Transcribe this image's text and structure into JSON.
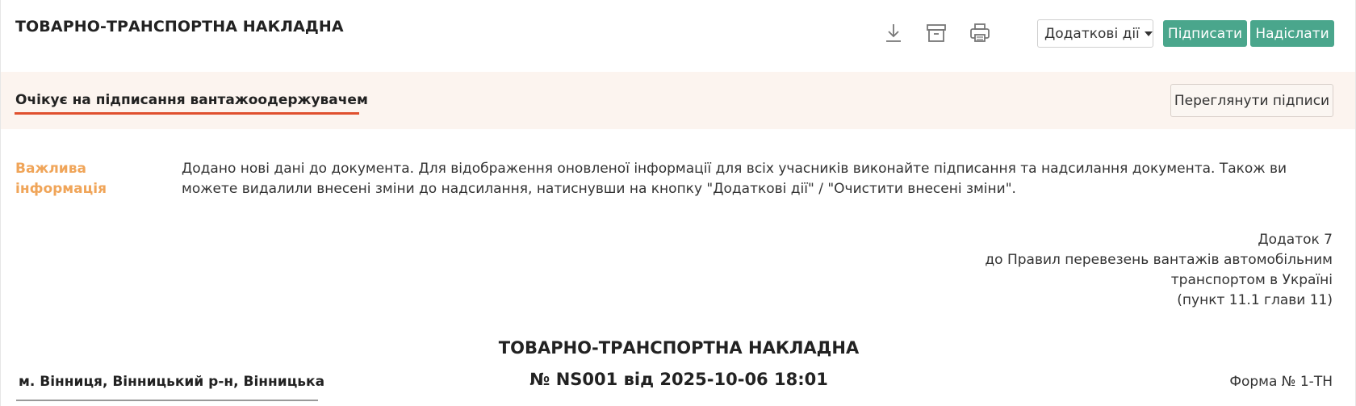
{
  "header": {
    "title": "ТОВАРНО-ТРАНСПОРТНА НАКЛАДНА",
    "icons": [
      "download-icon",
      "archive-icon",
      "print-icon"
    ],
    "more_actions_label": "Додаткові дії",
    "sign_label": "Підписати",
    "send_label": "Надіслати"
  },
  "status": {
    "text": "Очікує на підписання вантажоодержувачем",
    "view_signatures_label": "Переглянути підписи"
  },
  "info": {
    "label": "Важлива інформація",
    "text": "Додано нові дані до документа. Для відображення оновленої інформації для всіх учасників виконайте підписання та надсилання документа. Також ви можете видалили внесені зміни до надсилання, натиснувши на кнопку \"Додаткові дії\" / \"Очистити внесені зміни\"."
  },
  "appendix": {
    "line1": "Додаток 7",
    "line2": "до Правил перевезень вантажів автомобільним",
    "line3": "транспортом в Україні",
    "line4": "(пункт 11.1 глави 11)"
  },
  "document": {
    "title": "ТОВАРНО-ТРАНСПОРТНА НАКЛАДНА",
    "number": "№ NS001 від 2025-10-06 18:01",
    "city": "м. Вінниця, Вінницький р-н, Вінницька",
    "form": "Форма № 1-ТН"
  },
  "colors": {
    "accent_green": "#4aa68c",
    "status_bg": "#fcf4ef",
    "status_underline": "#e0502e",
    "info_label": "#f0a559"
  }
}
